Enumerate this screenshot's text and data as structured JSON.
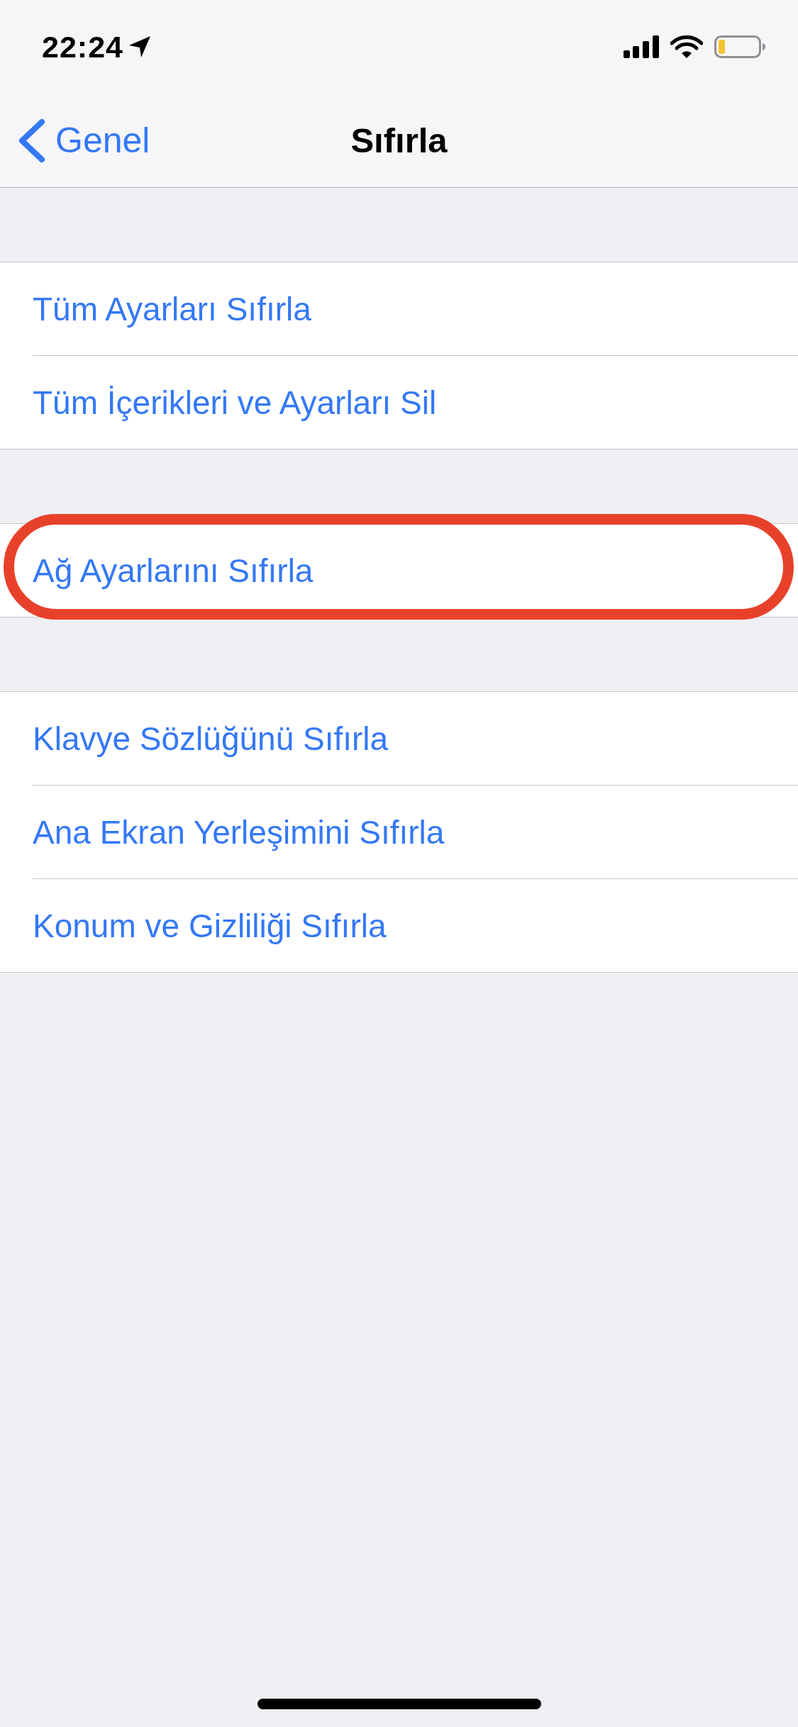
{
  "status_bar": {
    "time": "22:24"
  },
  "nav_bar": {
    "back": "Genel",
    "title": "Sıfırla"
  },
  "groups": [
    {
      "items": [
        {
          "label": "Tüm Ayarları Sıfırla",
          "highlighted": false
        },
        {
          "label": "Tüm İçerikleri ve Ayarları Sil",
          "highlighted": false
        }
      ]
    },
    {
      "items": [
        {
          "label": "Ağ Ayarlarını Sıfırla",
          "highlighted": true
        }
      ]
    },
    {
      "items": [
        {
          "label": "Klavye Sözlüğünü Sıfırla",
          "highlighted": false
        },
        {
          "label": "Ana Ekran Yerleşimini Sıfırla",
          "highlighted": false
        },
        {
          "label": "Konum ve Gizliliği Sıfırla",
          "highlighted": false
        }
      ]
    }
  ]
}
